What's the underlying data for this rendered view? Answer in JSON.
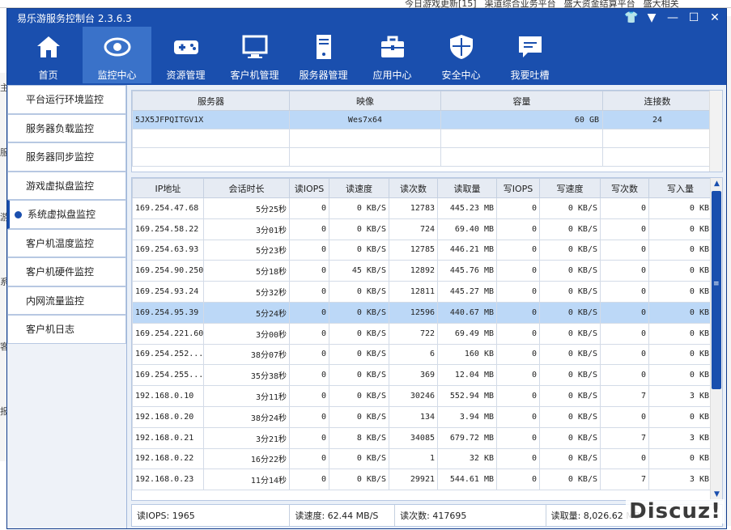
{
  "background": {
    "top_links": [
      "今日游戏更新[15]",
      "渠道综合业务平台",
      "盛大资金结算平台",
      "盛大相关"
    ],
    "left_glyphs": [
      "主",
      "服",
      "游",
      "系",
      "客",
      "报"
    ]
  },
  "window": {
    "title": "易乐游服务控制台 2.3.6.3",
    "controls": [
      "👕",
      "▼",
      "—",
      "☐",
      "✕"
    ]
  },
  "toolbar": [
    {
      "label": "首页",
      "icon": "home-icon"
    },
    {
      "label": "监控中心",
      "icon": "eye-icon",
      "active": true
    },
    {
      "label": "资源管理",
      "icon": "gamepad-icon"
    },
    {
      "label": "客户机管理",
      "icon": "monitor-icon"
    },
    {
      "label": "服务器管理",
      "icon": "server-icon"
    },
    {
      "label": "应用中心",
      "icon": "toolbox-icon"
    },
    {
      "label": "安全中心",
      "icon": "shield-icon"
    },
    {
      "label": "我要吐槽",
      "icon": "chat-icon"
    }
  ],
  "sidebar": [
    {
      "label": "平台运行环境监控"
    },
    {
      "label": "服务器负载监控"
    },
    {
      "label": "服务器同步监控"
    },
    {
      "label": "游戏虚拟盘监控"
    },
    {
      "label": "系统虚拟盘监控",
      "active": true
    },
    {
      "label": "客户机温度监控"
    },
    {
      "label": "客户机硬件监控"
    },
    {
      "label": "内网流量监控"
    },
    {
      "label": "客户机日志"
    }
  ],
  "server_table": {
    "headers": [
      "服务器",
      "映像",
      "容量",
      "连接数"
    ],
    "rows": [
      [
        "5JX5JFPQITGV1X",
        "Wes7x64",
        "60 GB",
        "24"
      ]
    ]
  },
  "client_table": {
    "headers": [
      "IP地址",
      "会话时长",
      "读IOPS",
      "读速度",
      "读次数",
      "读取量",
      "写IOPS",
      "写速度",
      "写次数",
      "写入量"
    ],
    "rows": [
      [
        "169.254.47.68",
        "5分25秒",
        "0",
        "0 KB/S",
        "12783",
        "445.23 MB",
        "0",
        "0 KB/S",
        "0",
        "0 KB"
      ],
      [
        "169.254.58.22",
        "3分01秒",
        "0",
        "0 KB/S",
        "724",
        "69.40 MB",
        "0",
        "0 KB/S",
        "0",
        "0 KB"
      ],
      [
        "169.254.63.93",
        "5分23秒",
        "0",
        "0 KB/S",
        "12785",
        "446.21 MB",
        "0",
        "0 KB/S",
        "0",
        "0 KB"
      ],
      [
        "169.254.90.250",
        "5分18秒",
        "0",
        "45 KB/S",
        "12892",
        "445.76 MB",
        "0",
        "0 KB/S",
        "0",
        "0 KB"
      ],
      [
        "169.254.93.24",
        "5分32秒",
        "0",
        "0 KB/S",
        "12811",
        "445.27 MB",
        "0",
        "0 KB/S",
        "0",
        "0 KB"
      ],
      [
        "169.254.95.39",
        "5分24秒",
        "0",
        "0 KB/S",
        "12596",
        "440.67 MB",
        "0",
        "0 KB/S",
        "0",
        "0 KB"
      ],
      [
        "169.254.221.60",
        "3分00秒",
        "0",
        "0 KB/S",
        "722",
        "69.49 MB",
        "0",
        "0 KB/S",
        "0",
        "0 KB"
      ],
      [
        "169.254.252...",
        "38分07秒",
        "0",
        "0 KB/S",
        "6",
        "160 KB",
        "0",
        "0 KB/S",
        "0",
        "0 KB"
      ],
      [
        "169.254.255...",
        "35分38秒",
        "0",
        "0 KB/S",
        "369",
        "12.04 MB",
        "0",
        "0 KB/S",
        "0",
        "0 KB"
      ],
      [
        "192.168.0.10",
        "3分11秒",
        "0",
        "0 KB/S",
        "30246",
        "552.94 MB",
        "0",
        "0 KB/S",
        "7",
        "3 KB"
      ],
      [
        "192.168.0.20",
        "38分24秒",
        "0",
        "0 KB/S",
        "134",
        "3.94 MB",
        "0",
        "0 KB/S",
        "0",
        "0 KB"
      ],
      [
        "192.168.0.21",
        "3分21秒",
        "0",
        "8 KB/S",
        "34085",
        "679.72 MB",
        "0",
        "0 KB/S",
        "7",
        "3 KB"
      ],
      [
        "192.168.0.22",
        "16分22秒",
        "0",
        "0 KB/S",
        "1",
        "32 KB",
        "0",
        "0 KB/S",
        "0",
        "0 KB"
      ],
      [
        "192.168.0.23",
        "11分14秒",
        "0",
        "0 KB/S",
        "29921",
        "544.61 MB",
        "0",
        "0 KB/S",
        "7",
        "3 KB"
      ]
    ],
    "selected_row": 5
  },
  "status": {
    "read_iops": "读IOPS: 1965",
    "read_speed": "读速度: 62.44 MB/S",
    "read_count": "读次数: 417695",
    "read_total": "读取量: 8,026.62 MB"
  },
  "watermark": "Discuz!"
}
